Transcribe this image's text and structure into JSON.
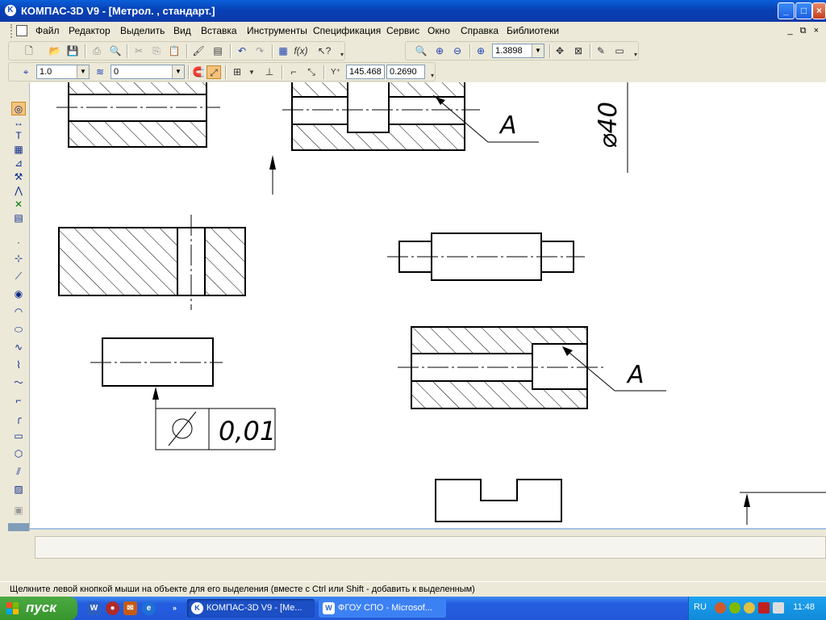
{
  "window": {
    "title": "КОМПАС-3D V9 - [Метрол. , стандарт.]",
    "app_icon_letter": "K",
    "buttons": {
      "minimize": "_",
      "maximize": "□",
      "close": "×"
    }
  },
  "menu": {
    "items": [
      "Файл",
      "Редактор",
      "Выделить",
      "Вид",
      "Вставка",
      "Инструменты",
      "Спецификация",
      "Сервис",
      "Окно",
      "Справка",
      "Библиотеки"
    ],
    "mdi_controls": "_ ⧉ ×"
  },
  "toolbar_standard": {
    "zoom_value": "1.3898"
  },
  "toolbar_current_state": {
    "scale_value": "1.0",
    "layer_value": "0",
    "x_coord": "145.468",
    "y_coord": "0.2690"
  },
  "drawing": {
    "label_a_1": "A",
    "label_a_2": "A",
    "diameter_label": "⌀40",
    "tolerance_value": "0,01"
  },
  "status": {
    "hint": "Щелкните левой кнопкой мыши на объекте для его выделения (вместе с Ctrl или Shift - добавить к выделенным)"
  },
  "taskbar": {
    "start_label": "пуск",
    "tasks": [
      {
        "label": "КОМПАС-3D V9 - [Ме...",
        "icon": "K",
        "active": true
      },
      {
        "label": "ФГОУ СПО - Microsof...",
        "icon": "W",
        "active": false
      }
    ],
    "lang": "RU",
    "clock": "11:48"
  },
  "colors": {
    "titlebar": "#0841b6",
    "taskbar": "#245ee0",
    "start": "#36952c",
    "tray": "#0f8ad8"
  }
}
